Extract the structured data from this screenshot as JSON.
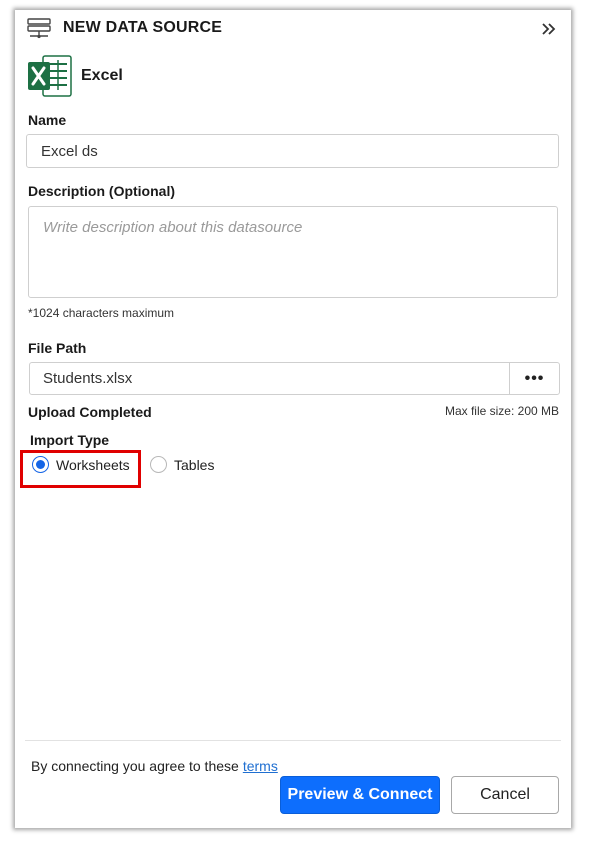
{
  "header": {
    "title": "NEW DATA SOURCE",
    "datasource_icon": "datasource-icon",
    "collapse_icon": "double-chevron-right-icon"
  },
  "source": {
    "name": "Excel",
    "icon": "excel-icon",
    "brand_color": "#1d7044"
  },
  "form": {
    "name_label": "Name",
    "name_value": "Excel ds",
    "description_label": "Description (Optional)",
    "description_placeholder": "Write description about this datasource",
    "description_hint": "*1024 characters maximum",
    "file_path_label": "File Path",
    "file_path_value": "Students.xlsx",
    "browse_label": "•••",
    "upload_status": "Upload Completed",
    "max_file_size": "Max file size: 200 MB",
    "import_type_label": "Import Type",
    "import_options": [
      {
        "label": "Worksheets",
        "selected": true
      },
      {
        "label": "Tables",
        "selected": false
      }
    ]
  },
  "footer": {
    "terms_prefix": "By connecting you agree to these",
    "terms_link": "terms",
    "primary_button": "Preview & Connect",
    "secondary_button": "Cancel"
  },
  "colors": {
    "accent": "#0d6efd",
    "highlight": "#e00000",
    "link": "#1f6fd1"
  }
}
